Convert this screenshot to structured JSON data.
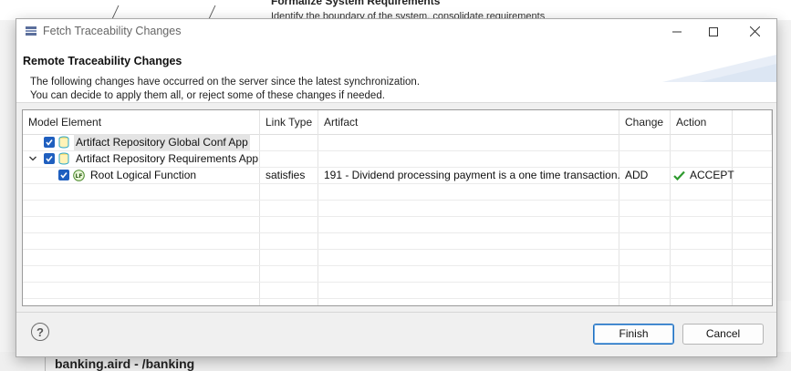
{
  "background": {
    "heading": "Formalize System Requirements",
    "subtext": "Identify the boundary of the system, consolidate requirements",
    "editor_tab": "banking.aird - /banking"
  },
  "dialog": {
    "title": "Fetch Traceability Changes",
    "header_title": "Remote Traceability Changes",
    "description_line1": "The following changes have occurred on the server since the latest synchronization.",
    "description_line2": "You can decide to apply them all, or reject some of these changes if needed.",
    "window_controls": {
      "minimize": "–",
      "maximize": "☐",
      "close": "✕"
    }
  },
  "table": {
    "columns": [
      "Model Element",
      "Link Type",
      "Artifact",
      "Change",
      "Action"
    ],
    "rows": [
      {
        "element": "Artifact Repository Global Conf App",
        "icon": "repository-icon",
        "checked": true,
        "link_type": "",
        "artifact": "",
        "change": "",
        "action": ""
      },
      {
        "element": "Artifact Repository Requirements App",
        "icon": "repository-icon",
        "checked": true,
        "expanded": true,
        "link_type": "",
        "artifact": "",
        "change": "",
        "action": ""
      },
      {
        "element": "Root Logical Function",
        "icon": "logical-function-icon",
        "checked": true,
        "link_type": "satisfies",
        "artifact": "191 - Dividend processing payment is a one time transaction.",
        "change": "ADD",
        "action": "ACCEPT"
      }
    ]
  },
  "footer": {
    "help_label": "?",
    "finish_label": "Finish",
    "cancel_label": "Cancel"
  },
  "colors": {
    "checkbox": "#1f5fbf",
    "accept_check": "#2e9a2e",
    "focus_border": "#1f6fc0"
  }
}
